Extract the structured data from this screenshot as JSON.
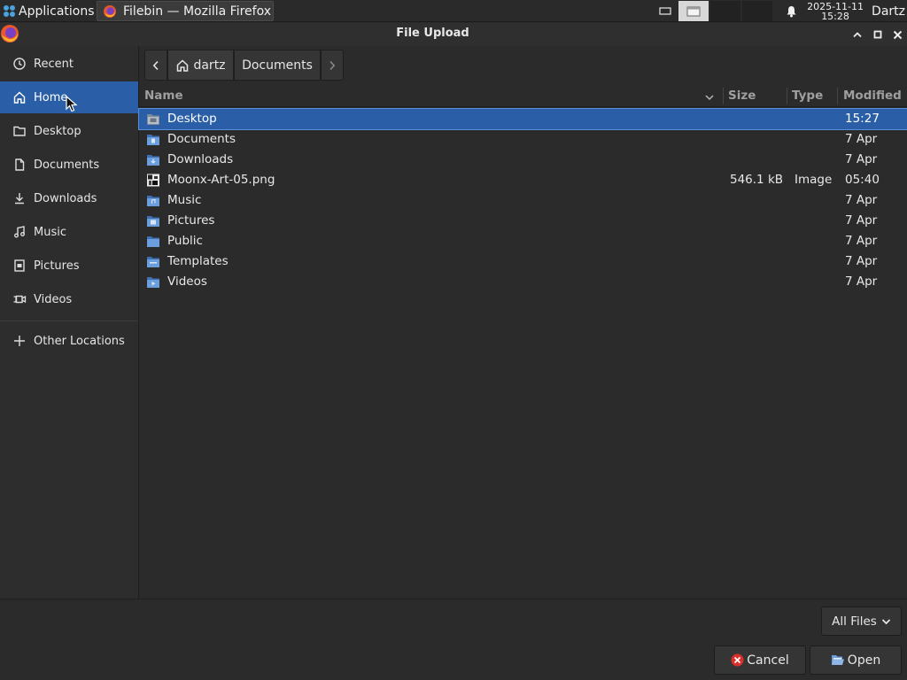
{
  "taskbar": {
    "applications_label": "Applications",
    "separator": "⁝",
    "window_title": "Filebin — Mozilla Firefox",
    "clock_date": "2025-11-11",
    "clock_time": "15:28",
    "user": "Dartz"
  },
  "dialog": {
    "title": "File Upload"
  },
  "sidebar": {
    "items": [
      {
        "label": "Recent",
        "icon": "clock-icon",
        "selected": false
      },
      {
        "label": "Home",
        "icon": "home-icon",
        "selected": true
      },
      {
        "label": "Desktop",
        "icon": "folder-icon",
        "selected": false
      },
      {
        "label": "Documents",
        "icon": "document-icon",
        "selected": false
      },
      {
        "label": "Downloads",
        "icon": "download-icon",
        "selected": false
      },
      {
        "label": "Music",
        "icon": "music-icon",
        "selected": false
      },
      {
        "label": "Pictures",
        "icon": "picture-icon",
        "selected": false
      },
      {
        "label": "Videos",
        "icon": "video-icon",
        "selected": false
      }
    ],
    "other_locations": "Other Locations"
  },
  "pathbar": {
    "home": "dartz",
    "current": "Documents"
  },
  "list": {
    "columns": {
      "name": "Name",
      "size": "Size",
      "type": "Type",
      "modified": "Modified"
    },
    "rows": [
      {
        "name": "Desktop",
        "size": "",
        "type": "",
        "modified": "15:27",
        "icon": "desktop-folder-icon",
        "selected": true
      },
      {
        "name": "Documents",
        "size": "",
        "type": "",
        "modified": "7 Apr",
        "icon": "documents-folder-icon",
        "selected": false
      },
      {
        "name": "Downloads",
        "size": "",
        "type": "",
        "modified": "7 Apr",
        "icon": "downloads-folder-icon",
        "selected": false
      },
      {
        "name": "Moonx-Art-05.png",
        "size": "546.1 kB",
        "type": "Image",
        "modified": "05:40",
        "icon": "image-file-icon",
        "selected": false
      },
      {
        "name": "Music",
        "size": "",
        "type": "",
        "modified": "7 Apr",
        "icon": "music-folder-icon",
        "selected": false
      },
      {
        "name": "Pictures",
        "size": "",
        "type": "",
        "modified": "7 Apr",
        "icon": "pictures-folder-icon",
        "selected": false
      },
      {
        "name": "Public",
        "size": "",
        "type": "",
        "modified": "7 Apr",
        "icon": "public-folder-icon",
        "selected": false
      },
      {
        "name": "Templates",
        "size": "",
        "type": "",
        "modified": "7 Apr",
        "icon": "templates-folder-icon",
        "selected": false
      },
      {
        "name": "Videos",
        "size": "",
        "type": "",
        "modified": "7 Apr",
        "icon": "videos-folder-icon",
        "selected": false
      }
    ]
  },
  "footer": {
    "filter_label": "All Files",
    "cancel_label": "Cancel",
    "open_label": "Open"
  },
  "colors": {
    "selection": "#2a5fa8",
    "background": "#2b2b2b",
    "folder_blue": "#5b8fd0",
    "cancel_red": "#d9302c"
  }
}
